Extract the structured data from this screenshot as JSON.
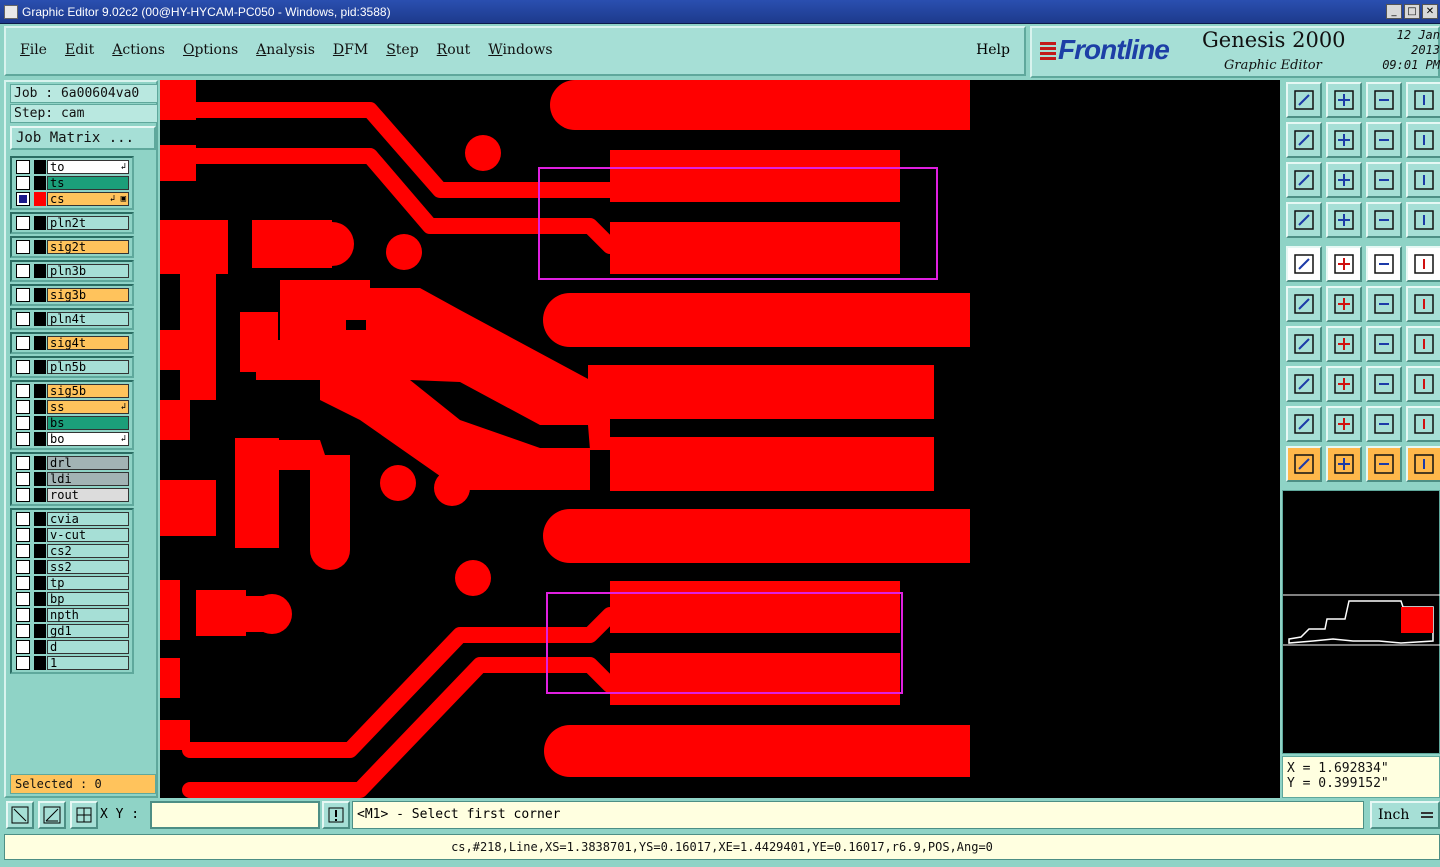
{
  "window": {
    "title": "Graphic Editor 9.02c2 (00@HY-HYCAM-PC050 - Windows, pid:3588)",
    "controls": [
      "_",
      "□",
      "✕"
    ]
  },
  "menu": {
    "items": [
      "File",
      "Edit",
      "Actions",
      "Options",
      "Analysis",
      "DFM",
      "Step",
      "Rout",
      "Windows"
    ],
    "help": "Help"
  },
  "brand": {
    "logo": "Frontline",
    "product": "Genesis 2000",
    "subtitle": "Graphic Editor",
    "date": "12 Jan 2013",
    "time": "09:01 PM",
    "logo_color": "#1d3fa6"
  },
  "job": {
    "job_label": "Job : 6a00604va0",
    "step_label": "Step: cam",
    "matrix_button": "Job Matrix ..."
  },
  "layers": {
    "groups": [
      [
        {
          "name": "to",
          "bg": "bg-white",
          "tag": "↲",
          "checked": false,
          "color": "black"
        },
        {
          "name": "ts",
          "bg": "bg-teal",
          "tag": "",
          "checked": false,
          "color": "black"
        },
        {
          "name": "cs",
          "bg": "bg-orange",
          "tag": "↲ ▣",
          "checked": true,
          "color": "red"
        }
      ],
      [
        {
          "name": "pln2t",
          "bg": "bg-light",
          "tag": "",
          "checked": false,
          "color": "black"
        }
      ],
      [
        {
          "name": "sig2t",
          "bg": "bg-orange",
          "tag": "",
          "checked": false,
          "color": "black"
        }
      ],
      [
        {
          "name": "pln3b",
          "bg": "bg-light",
          "tag": "",
          "checked": false,
          "color": "black"
        }
      ],
      [
        {
          "name": "sig3b",
          "bg": "bg-orange",
          "tag": "",
          "checked": false,
          "color": "black"
        }
      ],
      [
        {
          "name": "pln4t",
          "bg": "bg-light",
          "tag": "",
          "checked": false,
          "color": "black"
        }
      ],
      [
        {
          "name": "sig4t",
          "bg": "bg-orange",
          "tag": "",
          "checked": false,
          "color": "black"
        }
      ],
      [
        {
          "name": "pln5b",
          "bg": "bg-light",
          "tag": "",
          "checked": false,
          "color": "black"
        }
      ],
      [
        {
          "name": "sig5b",
          "bg": "bg-orange",
          "tag": "",
          "checked": false,
          "color": "black"
        },
        {
          "name": "ss",
          "bg": "bg-orange",
          "tag": "↲",
          "checked": false,
          "color": "black"
        },
        {
          "name": "bs",
          "bg": "bg-teal",
          "tag": "",
          "checked": false,
          "color": "black"
        },
        {
          "name": "bo",
          "bg": "bg-white",
          "tag": "↲",
          "checked": false,
          "color": "black"
        }
      ],
      [
        {
          "name": "drl",
          "bg": "bg-grey",
          "tag": "",
          "checked": false,
          "color": "black"
        },
        {
          "name": "ldi",
          "bg": "bg-grey",
          "tag": "",
          "checked": false,
          "color": "black"
        },
        {
          "name": "rout",
          "bg": "bg-lgrey",
          "tag": "",
          "checked": false,
          "color": "black"
        }
      ],
      [
        {
          "name": "cvia",
          "bg": "bg-light",
          "tag": "",
          "checked": false,
          "color": "black"
        },
        {
          "name": "v-cut",
          "bg": "bg-light",
          "tag": "",
          "checked": false,
          "color": "black"
        },
        {
          "name": "cs2",
          "bg": "bg-light",
          "tag": "",
          "checked": false,
          "color": "black"
        },
        {
          "name": "ss2",
          "bg": "bg-light",
          "tag": "",
          "checked": false,
          "color": "black"
        },
        {
          "name": "tp",
          "bg": "bg-light",
          "tag": "",
          "checked": false,
          "color": "black"
        },
        {
          "name": "bp",
          "bg": "bg-light",
          "tag": "",
          "checked": false,
          "color": "black"
        },
        {
          "name": "npth",
          "bg": "bg-light",
          "tag": "",
          "checked": false,
          "color": "black"
        },
        {
          "name": "gd1",
          "bg": "bg-light",
          "tag": "",
          "checked": false,
          "color": "black"
        },
        {
          "name": "d",
          "bg": "bg-light",
          "tag": "",
          "checked": false,
          "color": "black"
        },
        {
          "name": "1",
          "bg": "bg-light",
          "tag": "",
          "checked": false,
          "color": "black"
        }
      ]
    ],
    "selected_label": "Selected : 0"
  },
  "canvas": {
    "copper_color": "#ff0000",
    "background": "#000000",
    "selection_color": "#e020e0"
  },
  "coords": {
    "x": "X = 1.692834\"",
    "y": "Y = 0.399152\""
  },
  "prompt": {
    "xy_label": "X Y :",
    "xy_value": "",
    "message": "<M1> - Select first corner",
    "unit": "Inch"
  },
  "status": {
    "text": "cs,#218,Line,XS=1.3838701,YS=0.16017,XE=1.4429401,YE=0.16017,r6.9,POS,Ang=0"
  }
}
